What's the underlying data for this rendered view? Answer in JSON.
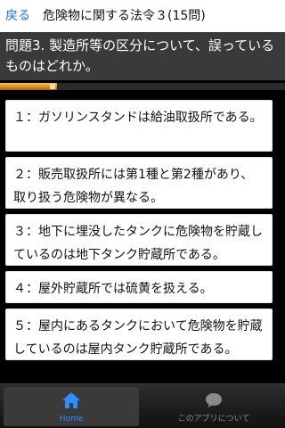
{
  "header": {
    "back_label": "戻る",
    "title": "危険物に関する法令３(15問)"
  },
  "question": {
    "text": "問題3. 製造所等の区分について、誤っているものはどれか。"
  },
  "progress": {
    "fraction": 0.2,
    "color": "#d8901f"
  },
  "answers": [
    {
      "text": "１：ガソリンスタンドは給油取扱所である。"
    },
    {
      "text": "２：販売取扱所には第1種と第2種があり、取り扱う危険物が異なる。"
    },
    {
      "text": "３：地下に埋没したタンクに危険物を貯蔵しているのは地下タンク貯蔵所である。"
    },
    {
      "text": "４：屋外貯蔵所では硫黄を扱える。"
    },
    {
      "text": "５：屋内にあるタンクにおいて危険物を貯蔵しているのは屋内タンク貯蔵所である。"
    }
  ],
  "tabs": [
    {
      "label": "Home",
      "icon": "home-icon",
      "active": true,
      "color": "#2f8dff"
    },
    {
      "label": "このアプリについて",
      "icon": "speech-bubble-icon",
      "active": false,
      "color": "#8a8a8a"
    }
  ]
}
